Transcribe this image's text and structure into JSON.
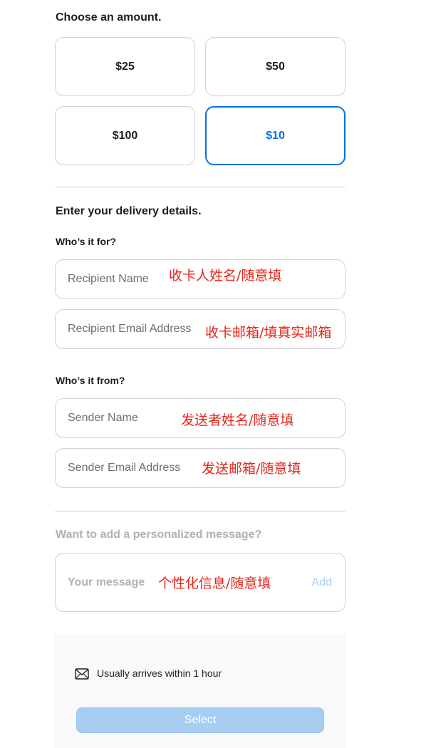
{
  "amount_section": {
    "heading": "Choose an amount.",
    "options": [
      {
        "label": "$25",
        "selected": false
      },
      {
        "label": "$50",
        "selected": false
      },
      {
        "label": "$100",
        "selected": false
      },
      {
        "label": "$10",
        "selected": true
      }
    ]
  },
  "delivery_section": {
    "heading": "Enter your delivery details.",
    "recipient_heading": "Who’s it for?",
    "recipient_name_placeholder": "Recipient Name",
    "recipient_name_note": "收卡人姓名/随意填",
    "recipient_email_placeholder": "Recipient Email Address",
    "recipient_email_note": "收卡邮箱/填真实邮箱",
    "sender_heading": "Who’s it from?",
    "sender_name_placeholder": "Sender Name",
    "sender_name_note": "发送者姓名/随意填",
    "sender_email_placeholder": "Sender Email Address",
    "sender_email_note": "发送邮箱/随意填"
  },
  "message_section": {
    "heading": "Want to add a personalized message?",
    "placeholder": "Your message",
    "note": "个性化信息/随意填",
    "add_label": "Add"
  },
  "delivery_info": {
    "icon": "envelope-icon",
    "text": "Usually arrives within 1 hour",
    "select_label": "Select"
  },
  "colors": {
    "accent": "#0071e3",
    "annotation": "#e8251a",
    "select_disabled": "#a8cdf3"
  }
}
